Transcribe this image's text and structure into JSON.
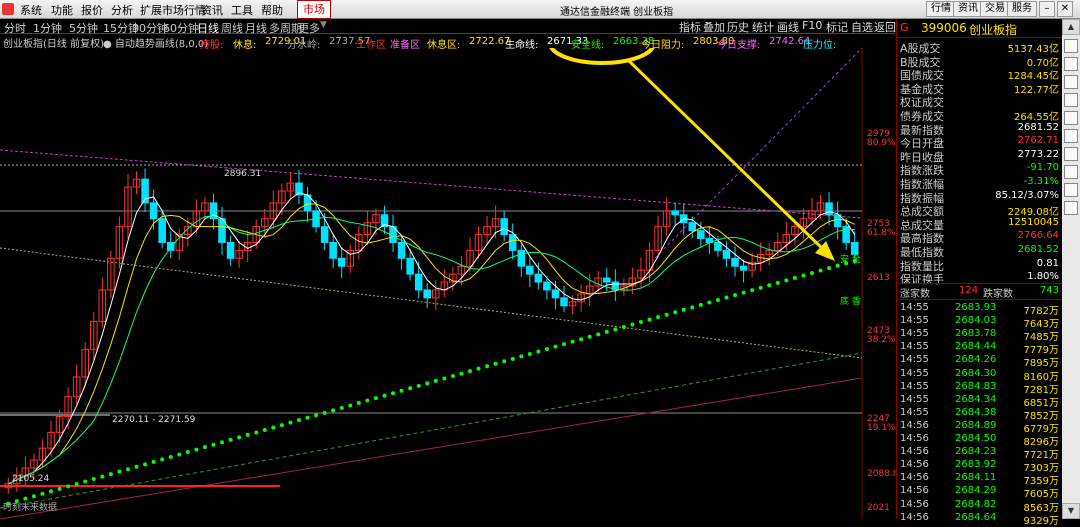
{
  "menu": [
    "系统",
    "功能",
    "报价",
    "分析",
    "扩展市场行情",
    "资讯",
    "工具",
    "帮助"
  ],
  "market_tab": "市场",
  "window_title": "通达信金融终端  创业板指",
  "right_buttons": [
    "行情",
    "资讯",
    "交易",
    "服务"
  ],
  "periods": [
    "分时",
    "1分钟",
    "5分钟",
    "15分钟",
    "30分钟",
    "60分钟",
    "日线",
    "周线",
    "月线",
    "多周期",
    "更多"
  ],
  "active_period": "日线",
  "tools": [
    "指标",
    "叠加",
    "历史",
    "统计",
    "画线",
    "F10",
    "标记",
    "自选",
    "返回"
  ],
  "info": {
    "title": "创业板指(日线 前复权)",
    "indicator": "● 自动趋势画线(8,0,0)",
    "items": [
      {
        "label": "持股:",
        "value": "",
        "color": "#ff3030"
      },
      {
        "label": "休息:",
        "value": "2729.01",
        "color": "#ffe000"
      },
      {
        "label": "分水岭:",
        "value": "2737.57",
        "color": "#aaaaaa"
      },
      {
        "label": "工作区",
        "value": "",
        "color": "#ff3030"
      },
      {
        "label": "准备区",
        "value": "",
        "color": "#ff60ff"
      },
      {
        "label": "休息区:",
        "value": "2722.67",
        "color": "#ffe000"
      },
      {
        "label": "生命线:",
        "value": "2671.33",
        "color": "#ffffff"
      },
      {
        "label": "安全线:",
        "value": "2663.38",
        "color": "#00ff00"
      },
      {
        "label": "今日阻力:",
        "value": "2803.80",
        "color": "#ffe000"
      },
      {
        "label": "今日支撑:",
        "value": "2742.64",
        "color": "#ff60ff"
      },
      {
        "label": "压力位:",
        "value": "",
        "color": "#00ffff"
      }
    ]
  },
  "chart_data": {
    "type": "candlestick",
    "y_ticks": [
      {
        "value": "2979",
        "pct": "80.9%"
      },
      {
        "value": "2753",
        "pct": "61.8%"
      },
      {
        "value": "2613",
        "pct": ""
      },
      {
        "value": "2473",
        "pct": "38.2%"
      },
      {
        "value": "2247",
        "pct": "19.1%"
      },
      {
        "value": "2088.8",
        "pct": ""
      },
      {
        "value": "2021",
        "pct": ""
      }
    ],
    "annotations": {
      "high": "2896.31",
      "low": "2105.24",
      "range": "2270.11 - 2271.59",
      "safe_label": "安 全",
      "bottom_label": "底 香",
      "rest_label": "休",
      "life_label": "休",
      "footnote": "时刻未来数据",
      "seq_top": [
        "6",
        "7",
        "8",
        "9",
        "4",
        "5"
      ],
      "seq_bottom": [
        "3",
        "4",
        "5",
        "6",
        "7",
        "8"
      ],
      "seq_mid": [
        "8",
        "9",
        "7"
      ]
    }
  },
  "quote": {
    "code": "399006",
    "name": "创业板指",
    "flag": "G",
    "rows": [
      {
        "k": "A股成交",
        "v": "5137.43亿",
        "c": "#ffe000"
      },
      {
        "k": "B股成交",
        "v": "0.70亿",
        "c": "#ffe000"
      },
      {
        "k": "国债成交",
        "v": "1284.45亿",
        "c": "#ffe000"
      },
      {
        "k": "基金成交",
        "v": "122.77亿",
        "c": "#ffe000"
      },
      {
        "k": "权证成交",
        "v": "",
        "c": "#ffe000"
      },
      {
        "k": "债券成交",
        "v": "264.55亿",
        "c": "#ffe000"
      },
      {
        "k": "最新指数",
        "v": "2681.52",
        "c": "#ffffff"
      },
      {
        "k": "今日开盘",
        "v": "2762.71",
        "c": "#ff3030"
      },
      {
        "k": "昨日收盘",
        "v": "2773.22",
        "c": "#ffffff"
      },
      {
        "k": "指数涨跌",
        "v": "-91.70",
        "c": "#00ff00"
      },
      {
        "k": "指数涨幅",
        "v": "-3.31%",
        "c": "#00ff00"
      },
      {
        "k": "指数振幅",
        "v": "85.12/3.07%",
        "c": "#ffffff"
      },
      {
        "k": "总成交额",
        "v": "2249.08亿",
        "c": "#ffe000"
      },
      {
        "k": "总成交量",
        "v": "12510045",
        "c": "#ffe000"
      },
      {
        "k": "最高指数",
        "v": "2766.64",
        "c": "#ff3030"
      },
      {
        "k": "最低指数",
        "v": "2681.52",
        "c": "#00ff00"
      },
      {
        "k": "指数量比",
        "v": "0.81",
        "c": "#ffffff"
      },
      {
        "k": "保证换手",
        "v": "1.80%",
        "c": "#ffffff"
      }
    ],
    "updown": {
      "up_label": "涨家数",
      "up": "124",
      "down_label": "跌家数",
      "down": "743"
    },
    "ticks": [
      {
        "t": "14:55",
        "p": "2683.93",
        "v": "7782万"
      },
      {
        "t": "14:55",
        "p": "2684.03",
        "v": "7643万"
      },
      {
        "t": "14:55",
        "p": "2683.78",
        "v": "7485万"
      },
      {
        "t": "14:55",
        "p": "2684.44",
        "v": "7779万"
      },
      {
        "t": "14:55",
        "p": "2684.26",
        "v": "7895万"
      },
      {
        "t": "14:55",
        "p": "2684.30",
        "v": "8160万"
      },
      {
        "t": "14:55",
        "p": "2684.83",
        "v": "7281万"
      },
      {
        "t": "14:55",
        "p": "2684.34",
        "v": "6851万"
      },
      {
        "t": "14:55",
        "p": "2684.38",
        "v": "7852万"
      },
      {
        "t": "14:56",
        "p": "2684.89",
        "v": "6779万"
      },
      {
        "t": "14:56",
        "p": "2684.50",
        "v": "8296万"
      },
      {
        "t": "14:56",
        "p": "2684.23",
        "v": "7721万"
      },
      {
        "t": "14:56",
        "p": "2683.92",
        "v": "7303万"
      },
      {
        "t": "14:56",
        "p": "2684.11",
        "v": "7359万"
      },
      {
        "t": "14:56",
        "p": "2684.29",
        "v": "7605万"
      },
      {
        "t": "14:56",
        "p": "2684.82",
        "v": "8563万"
      },
      {
        "t": "14:56",
        "p": "2684.64",
        "v": "9329万"
      }
    ]
  }
}
